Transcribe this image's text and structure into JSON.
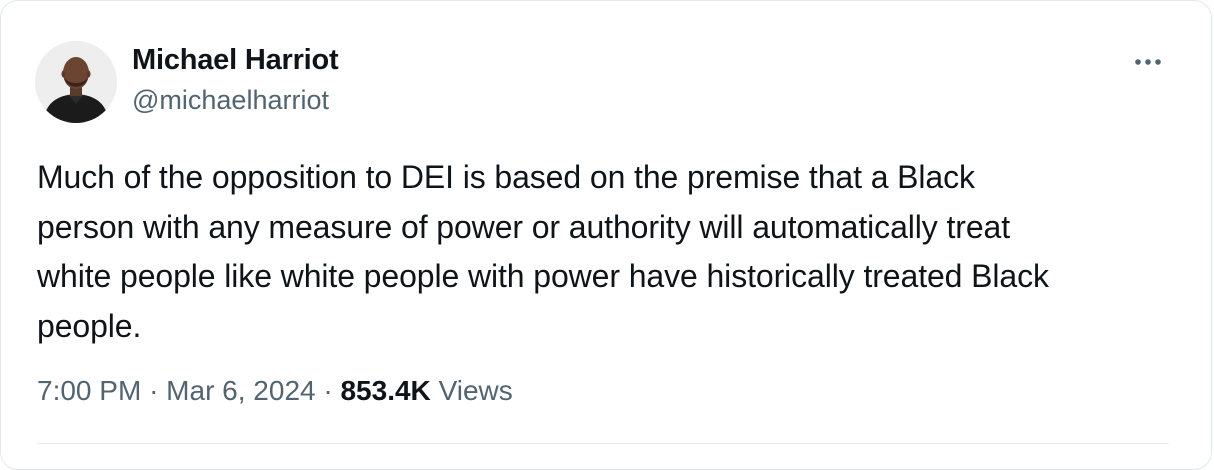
{
  "author": {
    "name": "Michael Harriot",
    "handle": "@michaelharriot"
  },
  "tweet": {
    "text": "Much of the opposition to DEI is based on the premise that a Black\nperson with any measure of power or authority will automatically treat\nwhite people like white people with power have historically treated Black\npeople.",
    "time": "7:00 PM",
    "separator": "·",
    "date": "Mar 6, 2024",
    "views_count": "853.4K",
    "views_label": "Views"
  },
  "icons": {
    "more": "more-horizontal-icon",
    "avatar": "user-avatar"
  },
  "colors": {
    "text_primary": "#0f1419",
    "text_secondary": "#536471",
    "border": "#e1e8ed"
  }
}
